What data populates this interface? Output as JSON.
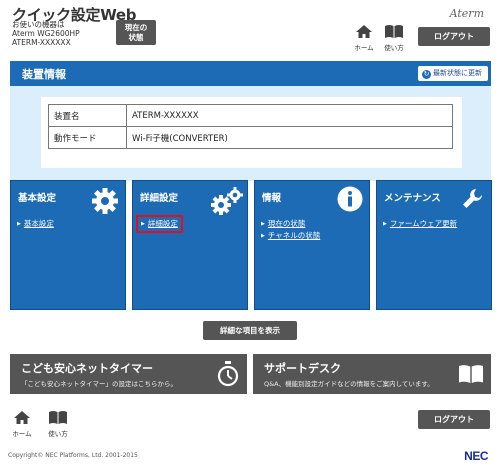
{
  "header": {
    "title": "クイック設定Web",
    "device_lines": [
      "お使いの機器は",
      "Aterm WG2600HP",
      "ATERM-XXXXXX"
    ],
    "status_button": [
      "現在の",
      "状態"
    ],
    "nav": {
      "home": "ホーム",
      "help": "使い方"
    },
    "brand": "Aterm",
    "logout": "ログアウト"
  },
  "device_info": {
    "title": "装置情報",
    "refresh": "最新状態に更新",
    "rows": [
      {
        "key": "装置名",
        "value": "ATERM-XXXXXX"
      },
      {
        "key": "動作モード",
        "value": "Wi-Fi子機(CONVERTER)"
      }
    ]
  },
  "tiles": [
    {
      "title": "基本設定",
      "links": [
        "基本設定"
      ]
    },
    {
      "title": "詳細設定",
      "links": [
        "詳細設定"
      ]
    },
    {
      "title": "情報",
      "links": [
        "現在の状態",
        "チャネルの状態"
      ]
    },
    {
      "title": "メンテナンス",
      "links": [
        "ファームウェア更新"
      ]
    }
  ],
  "show_detail_button": "詳細な項目を表示",
  "banners": {
    "timer": {
      "title": "こども安心ネットタイマー",
      "sub": "「こども安心ネットタイマー」の設定はこちらから。"
    },
    "support": {
      "title": "サポートデスク",
      "sub": "Q&A、機能別設定ガイドなどの情報をご案内しています。"
    }
  },
  "footer": {
    "home": "ホーム",
    "help": "使い方",
    "logout": "ログアウト",
    "copyright": "Copyright© NEC Platforms, Ltd. 2001-2015",
    "logo": "NEC"
  },
  "colors": {
    "accent_blue": "#1d6bb4",
    "panel_bg": "#dbeefc",
    "button_gray": "#555555",
    "highlight_red": "#e0101e"
  }
}
